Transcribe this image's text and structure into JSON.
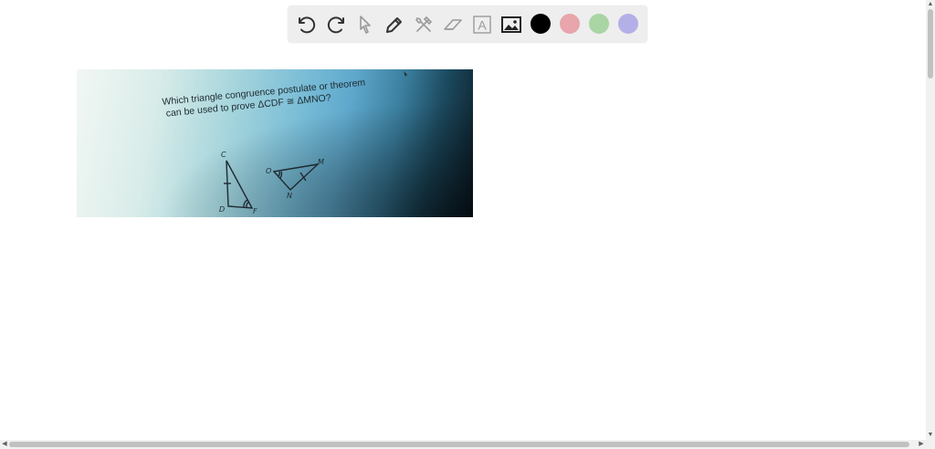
{
  "toolbar": {
    "tools": [
      {
        "name": "undo",
        "icon": "undo-icon"
      },
      {
        "name": "redo",
        "icon": "redo-icon"
      },
      {
        "name": "select",
        "icon": "pointer-icon"
      },
      {
        "name": "pen",
        "icon": "pencil-icon"
      },
      {
        "name": "tools",
        "icon": "hammer-wrench-icon"
      },
      {
        "name": "eraser",
        "icon": "eraser-icon"
      },
      {
        "name": "text",
        "icon": "text-box-icon",
        "glyph": "A"
      },
      {
        "name": "image",
        "icon": "image-icon"
      }
    ],
    "colors": [
      "#000000",
      "#e8a5ab",
      "#a9d5a4",
      "#b3b0e8"
    ]
  },
  "photo": {
    "question_line1": "Which triangle congruence postulate or theorem",
    "question_line2": "can be used to prove ΔCDF ≅ ΔMNO?",
    "labels": {
      "c": "C",
      "d": "D",
      "f": "F",
      "o": "O",
      "m": "M",
      "n": "N"
    }
  },
  "scrollbars": {
    "left_arrow": "◀",
    "right_arrow": "▶",
    "up_arrow": "▲",
    "down_arrow": "▼"
  }
}
